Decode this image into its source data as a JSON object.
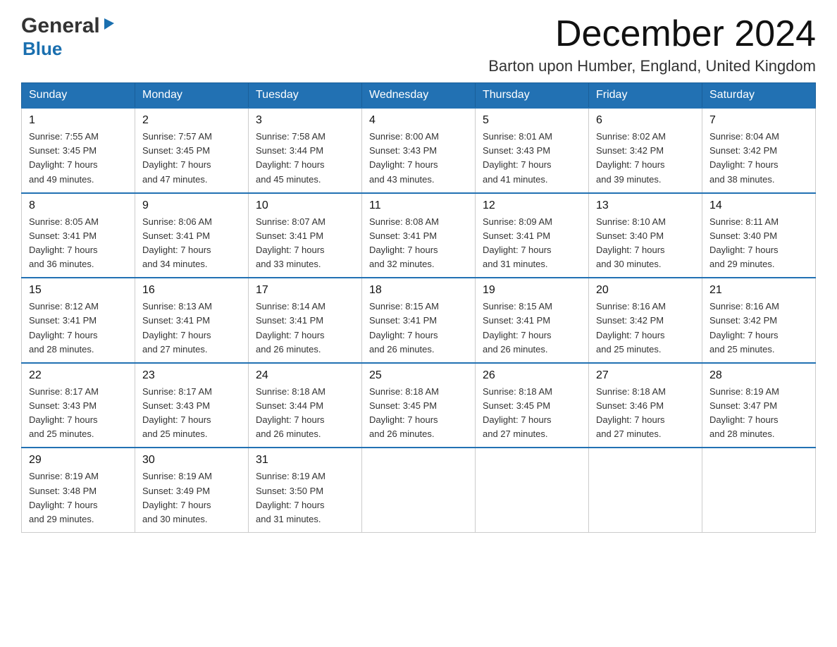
{
  "header": {
    "logo_general": "General",
    "logo_blue": "Blue",
    "month_year": "December 2024",
    "location": "Barton upon Humber, England, United Kingdom"
  },
  "days_of_week": [
    "Sunday",
    "Monday",
    "Tuesday",
    "Wednesday",
    "Thursday",
    "Friday",
    "Saturday"
  ],
  "weeks": [
    [
      {
        "day": "1",
        "sunrise": "7:55 AM",
        "sunset": "3:45 PM",
        "daylight": "7 hours and 49 minutes."
      },
      {
        "day": "2",
        "sunrise": "7:57 AM",
        "sunset": "3:45 PM",
        "daylight": "7 hours and 47 minutes."
      },
      {
        "day": "3",
        "sunrise": "7:58 AM",
        "sunset": "3:44 PM",
        "daylight": "7 hours and 45 minutes."
      },
      {
        "day": "4",
        "sunrise": "8:00 AM",
        "sunset": "3:43 PM",
        "daylight": "7 hours and 43 minutes."
      },
      {
        "day": "5",
        "sunrise": "8:01 AM",
        "sunset": "3:43 PM",
        "daylight": "7 hours and 41 minutes."
      },
      {
        "day": "6",
        "sunrise": "8:02 AM",
        "sunset": "3:42 PM",
        "daylight": "7 hours and 39 minutes."
      },
      {
        "day": "7",
        "sunrise": "8:04 AM",
        "sunset": "3:42 PM",
        "daylight": "7 hours and 38 minutes."
      }
    ],
    [
      {
        "day": "8",
        "sunrise": "8:05 AM",
        "sunset": "3:41 PM",
        "daylight": "7 hours and 36 minutes."
      },
      {
        "day": "9",
        "sunrise": "8:06 AM",
        "sunset": "3:41 PM",
        "daylight": "7 hours and 34 minutes."
      },
      {
        "day": "10",
        "sunrise": "8:07 AM",
        "sunset": "3:41 PM",
        "daylight": "7 hours and 33 minutes."
      },
      {
        "day": "11",
        "sunrise": "8:08 AM",
        "sunset": "3:41 PM",
        "daylight": "7 hours and 32 minutes."
      },
      {
        "day": "12",
        "sunrise": "8:09 AM",
        "sunset": "3:41 PM",
        "daylight": "7 hours and 31 minutes."
      },
      {
        "day": "13",
        "sunrise": "8:10 AM",
        "sunset": "3:40 PM",
        "daylight": "7 hours and 30 minutes."
      },
      {
        "day": "14",
        "sunrise": "8:11 AM",
        "sunset": "3:40 PM",
        "daylight": "7 hours and 29 minutes."
      }
    ],
    [
      {
        "day": "15",
        "sunrise": "8:12 AM",
        "sunset": "3:41 PM",
        "daylight": "7 hours and 28 minutes."
      },
      {
        "day": "16",
        "sunrise": "8:13 AM",
        "sunset": "3:41 PM",
        "daylight": "7 hours and 27 minutes."
      },
      {
        "day": "17",
        "sunrise": "8:14 AM",
        "sunset": "3:41 PM",
        "daylight": "7 hours and 26 minutes."
      },
      {
        "day": "18",
        "sunrise": "8:15 AM",
        "sunset": "3:41 PM",
        "daylight": "7 hours and 26 minutes."
      },
      {
        "day": "19",
        "sunrise": "8:15 AM",
        "sunset": "3:41 PM",
        "daylight": "7 hours and 26 minutes."
      },
      {
        "day": "20",
        "sunrise": "8:16 AM",
        "sunset": "3:42 PM",
        "daylight": "7 hours and 25 minutes."
      },
      {
        "day": "21",
        "sunrise": "8:16 AM",
        "sunset": "3:42 PM",
        "daylight": "7 hours and 25 minutes."
      }
    ],
    [
      {
        "day": "22",
        "sunrise": "8:17 AM",
        "sunset": "3:43 PM",
        "daylight": "7 hours and 25 minutes."
      },
      {
        "day": "23",
        "sunrise": "8:17 AM",
        "sunset": "3:43 PM",
        "daylight": "7 hours and 25 minutes."
      },
      {
        "day": "24",
        "sunrise": "8:18 AM",
        "sunset": "3:44 PM",
        "daylight": "7 hours and 26 minutes."
      },
      {
        "day": "25",
        "sunrise": "8:18 AM",
        "sunset": "3:45 PM",
        "daylight": "7 hours and 26 minutes."
      },
      {
        "day": "26",
        "sunrise": "8:18 AM",
        "sunset": "3:45 PM",
        "daylight": "7 hours and 27 minutes."
      },
      {
        "day": "27",
        "sunrise": "8:18 AM",
        "sunset": "3:46 PM",
        "daylight": "7 hours and 27 minutes."
      },
      {
        "day": "28",
        "sunrise": "8:19 AM",
        "sunset": "3:47 PM",
        "daylight": "7 hours and 28 minutes."
      }
    ],
    [
      {
        "day": "29",
        "sunrise": "8:19 AM",
        "sunset": "3:48 PM",
        "daylight": "7 hours and 29 minutes."
      },
      {
        "day": "30",
        "sunrise": "8:19 AM",
        "sunset": "3:49 PM",
        "daylight": "7 hours and 30 minutes."
      },
      {
        "day": "31",
        "sunrise": "8:19 AM",
        "sunset": "3:50 PM",
        "daylight": "7 hours and 31 minutes."
      },
      null,
      null,
      null,
      null
    ]
  ],
  "labels": {
    "sunrise_prefix": "Sunrise: ",
    "sunset_prefix": "Sunset: ",
    "daylight_prefix": "Daylight: "
  }
}
